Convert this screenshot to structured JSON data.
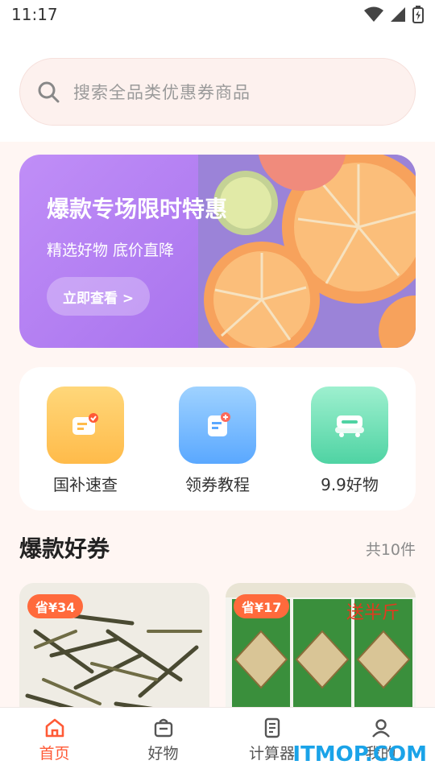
{
  "status": {
    "time": "11:17"
  },
  "search": {
    "placeholder": "搜索全品类优惠券商品"
  },
  "banner": {
    "title": "爆款专场限时特惠",
    "subtitle": "精选好物 底价直降",
    "button": "立即查看 >"
  },
  "quick": [
    {
      "label": "国补速查",
      "icon": "subsidy-check-icon",
      "color": "#ffc35a"
    },
    {
      "label": "领券教程",
      "icon": "coupon-tutorial-icon",
      "color": "#6fb6ff"
    },
    {
      "label": "9.9好物",
      "icon": "bargain-goods-icon",
      "color": "#62dbb1"
    }
  ],
  "section": {
    "title": "爆款好券",
    "count": "共10件"
  },
  "products": [
    {
      "badge": "省¥34"
    },
    {
      "badge": "省¥17"
    }
  ],
  "tabs": [
    {
      "label": "首页",
      "icon": "home-icon",
      "active": true
    },
    {
      "label": "好物",
      "icon": "bag-icon"
    },
    {
      "label": "计算器",
      "icon": "calculator-icon"
    },
    {
      "label": "我的",
      "icon": "user-icon"
    }
  ],
  "watermark": "ITMOP.COM",
  "colors": {
    "accent": "#ff5a36",
    "banner": "#b07ff2",
    "background": "#fff6f3"
  }
}
